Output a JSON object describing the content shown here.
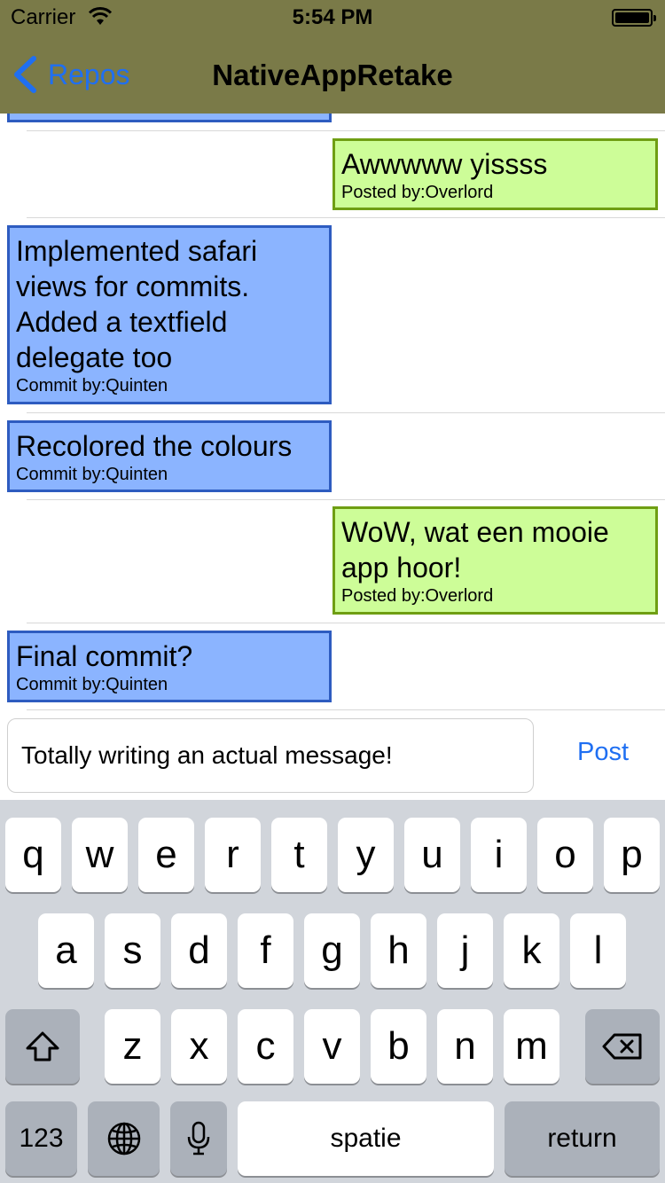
{
  "status_bar": {
    "carrier": "Carrier",
    "time": "5:54 PM"
  },
  "nav": {
    "back_label": "Repos",
    "title": "NativeAppRetake"
  },
  "messages": [
    {
      "type": "post",
      "text": "Awwwww yissss",
      "byline": "Posted by:Overlord"
    },
    {
      "type": "commit",
      "text": "Implemented safari views for commits. Added a textfield delegate too",
      "byline": "Commit by:Quinten"
    },
    {
      "type": "commit",
      "text": "Recolored the colours",
      "byline": "Commit by:Quinten"
    },
    {
      "type": "post",
      "text": "WoW, wat een mooie app hoor!",
      "byline": "Posted by:Overlord"
    },
    {
      "type": "commit",
      "text": "Final commit?",
      "byline": "Commit by:Quinten"
    }
  ],
  "composer": {
    "value": "Totally writing an actual message!",
    "post_label": "Post"
  },
  "keyboard": {
    "row1": [
      "q",
      "w",
      "e",
      "r",
      "t",
      "y",
      "u",
      "i",
      "o",
      "p"
    ],
    "row2": [
      "a",
      "s",
      "d",
      "f",
      "g",
      "h",
      "j",
      "k",
      "l"
    ],
    "row3": [
      "z",
      "x",
      "c",
      "v",
      "b",
      "n",
      "m"
    ],
    "numbers_label": "123",
    "space_label": "spatie",
    "return_label": "return",
    "shift_icon": "shift-icon",
    "globe_icon": "globe-icon",
    "mic_icon": "microphone-icon",
    "delete_icon": "delete-icon"
  },
  "colors": {
    "navbar": "#7a7a48",
    "commit_bubble": "#8bb4ff",
    "commit_border": "#2e5cc0",
    "post_bubble": "#cdfd98",
    "post_border": "#6f9e13",
    "tint": "#1f6ff2"
  }
}
